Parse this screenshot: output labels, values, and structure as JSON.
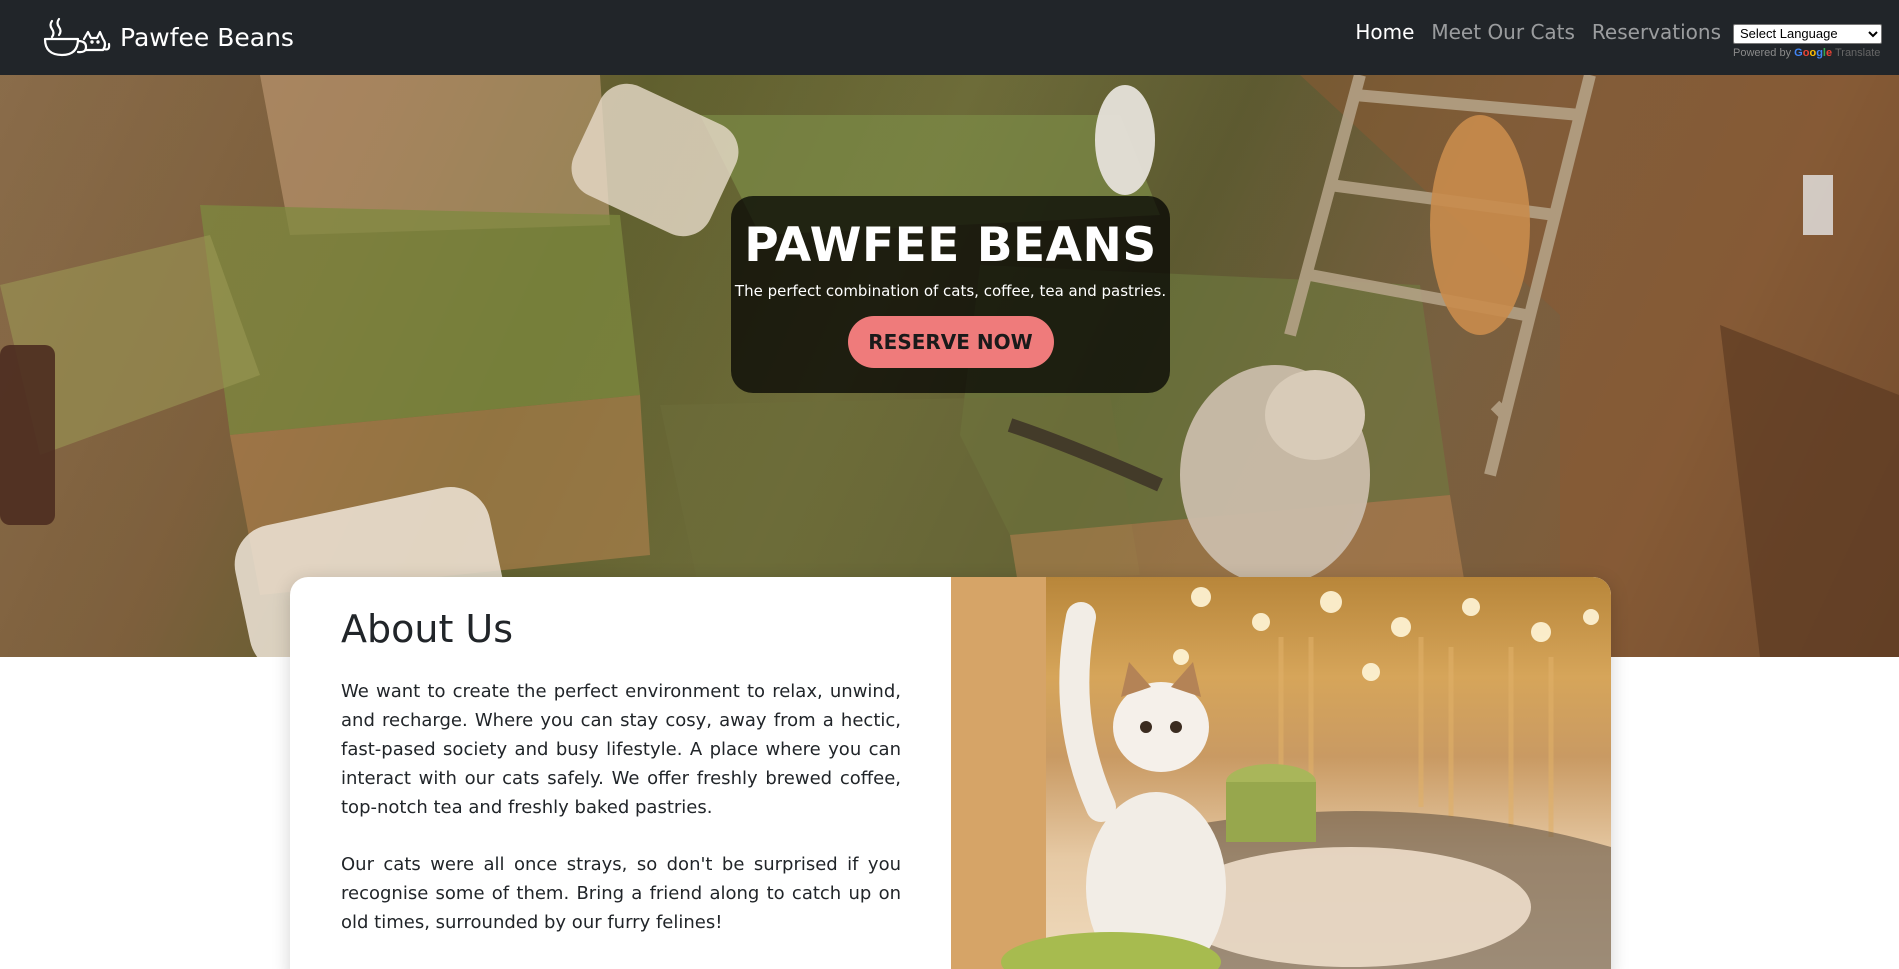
{
  "brand": {
    "name": "Pawfee Beans",
    "logo_icon": "cat-coffee-cup-icon"
  },
  "nav": {
    "items": [
      {
        "label": "Home",
        "active": true
      },
      {
        "label": "Meet Our Cats",
        "active": false
      },
      {
        "label": "Reservations",
        "active": false
      }
    ]
  },
  "translate": {
    "select_value": "Select Language",
    "powered_by": "Powered by",
    "google": "Google",
    "translate_label": "Translate"
  },
  "hero": {
    "title": "PAWFEE BEANS",
    "subtitle": "The perfect combination of cats, coffee, tea and pastries.",
    "cta_label": "RESERVE NOW"
  },
  "about": {
    "title": "About Us",
    "paragraphs": [
      "We want to create the perfect environment to relax, unwind, and recharge. Where you can stay cosy, away from a hectic, fast-pased society and busy lifestyle. A place where you can interact with our cats safely. We offer freshly brewed coffee, top-notch tea and freshly baked pastries.",
      "Our cats were all once strays, so don't be surprised if you recognise some of them. Bring a friend along to catch up on old times, surrounded by our furry felines!"
    ]
  },
  "colors": {
    "navbar_bg": "#212529",
    "cta_bg": "#ef7b7b",
    "text": "#212529"
  }
}
